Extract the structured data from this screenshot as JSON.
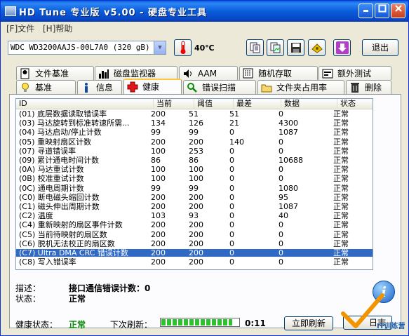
{
  "window": {
    "title": "HD Tune  专业版 v5.00 - 硬盘专业工具"
  },
  "menu": {
    "file": "[F]文件",
    "help": "[H]帮助"
  },
  "toolbar": {
    "drive": "WDC WD3200AAJS-00L7A0 (320 gB)",
    "temperature": "40℃",
    "exit_label": "退出"
  },
  "tabs_top": [
    {
      "label": "文件基准",
      "icon": "file-benchmark-icon"
    },
    {
      "label": "磁盘监视器",
      "icon": "disk-monitor-icon"
    },
    {
      "label": "AAM",
      "icon": "speaker-icon"
    },
    {
      "label": "随机存取",
      "icon": "random-access-icon"
    },
    {
      "label": "额外测试",
      "icon": "extra-tests-icon"
    }
  ],
  "tabs_bottom": [
    {
      "label": "基准",
      "icon": "benchmark-icon"
    },
    {
      "label": "信息",
      "icon": "info-icon"
    },
    {
      "label": "健康",
      "icon": "health-cross-icon",
      "active": true
    },
    {
      "label": "错误扫描",
      "icon": "error-scan-icon"
    },
    {
      "label": "文件夹占用率",
      "icon": "folder-icon"
    },
    {
      "label": "删除",
      "icon": "trash-icon"
    }
  ],
  "table": {
    "headers": {
      "id": "ID",
      "current": "当前",
      "threshold": "阈值",
      "worst": "最差",
      "data": "数据",
      "status": "状态"
    },
    "rows": [
      {
        "id": "(01) 底层数据读取错误率",
        "current": "200",
        "threshold": "51",
        "worst": "51",
        "data": "0",
        "status": "正常"
      },
      {
        "id": "(03) 马达旋转到标准转速所需...",
        "current": "134",
        "threshold": "126",
        "worst": "21",
        "data": "4300",
        "status": "正常"
      },
      {
        "id": "(04) 马达启动/停止计数",
        "current": "99",
        "threshold": "99",
        "worst": "0",
        "data": "1087",
        "status": "正常"
      },
      {
        "id": "(05) 重映射扇区计数",
        "current": "200",
        "threshold": "200",
        "worst": "140",
        "data": "0",
        "status": "正常"
      },
      {
        "id": "(07) 寻道错误率",
        "current": "100",
        "threshold": "253",
        "worst": "0",
        "data": "0",
        "status": "正常"
      },
      {
        "id": "(09) 累计通电时间计数",
        "current": "86",
        "threshold": "86",
        "worst": "0",
        "data": "10688",
        "status": "正常"
      },
      {
        "id": "(0A) 马达重试计数",
        "current": "100",
        "threshold": "100",
        "worst": "0",
        "data": "0",
        "status": "正常"
      },
      {
        "id": "(0B) 校准重试计数",
        "current": "100",
        "threshold": "100",
        "worst": "0",
        "data": "0",
        "status": "正常"
      },
      {
        "id": "(0C) 通电周期计数",
        "current": "99",
        "threshold": "99",
        "worst": "0",
        "data": "1080",
        "status": "正常"
      },
      {
        "id": "(C0) 断电磁头缩回计数",
        "current": "200",
        "threshold": "200",
        "worst": "0",
        "data": "95",
        "status": "正常"
      },
      {
        "id": "(C1) 磁头伸出周期计数",
        "current": "200",
        "threshold": "200",
        "worst": "0",
        "data": "1087",
        "status": "正常"
      },
      {
        "id": "(C2) 温度",
        "current": "103",
        "threshold": "93",
        "worst": "0",
        "data": "40",
        "status": "正常"
      },
      {
        "id": "(C4) 重新映射的扇区事件计数",
        "current": "200",
        "threshold": "200",
        "worst": "0",
        "data": "0",
        "status": "正常"
      },
      {
        "id": "(C5) 当前待映射的扇区数",
        "current": "200",
        "threshold": "200",
        "worst": "0",
        "data": "0",
        "status": "正常"
      },
      {
        "id": "(C6) 脱机无法校正的扇区数",
        "current": "200",
        "threshold": "200",
        "worst": "0",
        "data": "0",
        "status": "正常"
      },
      {
        "id": "(C7) Ultra DMA CRC 错误计数",
        "current": "200",
        "threshold": "200",
        "worst": "0",
        "data": "0",
        "status": "正常",
        "selected": true
      },
      {
        "id": "(C8) 写入错误率",
        "current": "200",
        "threshold": "200",
        "worst": "0",
        "data": "0",
        "status": "正常"
      }
    ]
  },
  "details": {
    "desc_label": "描述：",
    "desc_value": "接口通信错误计数：0",
    "status_label": "状态：",
    "status_value": "正常"
  },
  "footer": {
    "health_label": "健康状态：",
    "health_value": "正常",
    "next_refresh_label": "下次刷新：",
    "refresh_progress": 0.92,
    "countdown": "0:11",
    "refresh_button": "立即刷新",
    "log_button": "日志"
  },
  "watermark": {
    "text": "IT训练营"
  },
  "colors": {
    "selection": "#316ac5",
    "health_ok": "#0a8a0a",
    "title_bar": "#0a5ddb"
  }
}
